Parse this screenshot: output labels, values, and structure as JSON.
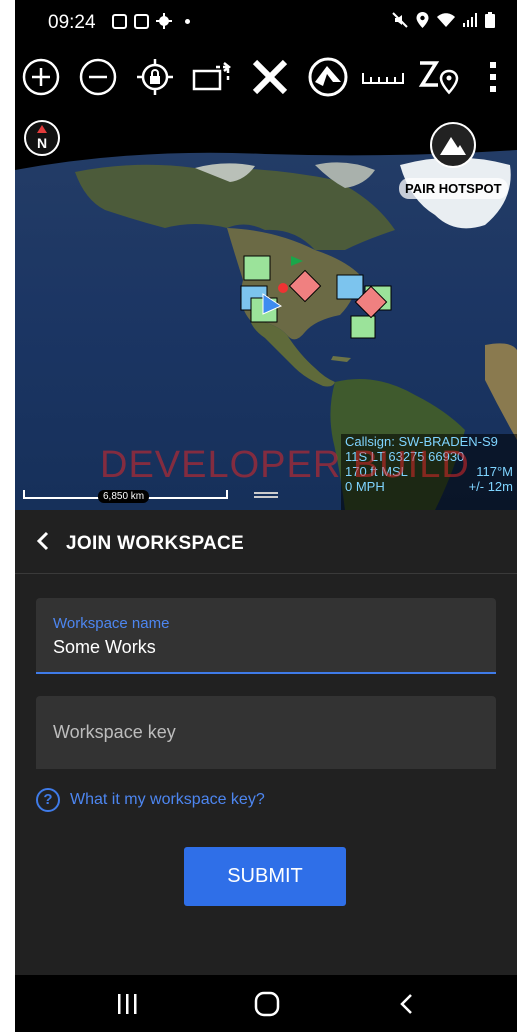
{
  "status_bar": {
    "time": "09:24",
    "left_icons": [
      "messenger-icon",
      "gallery-icon",
      "settings-icon",
      "dot-icon"
    ],
    "right_icons": [
      "mute-icon",
      "location-icon",
      "wifi-icon",
      "signal-icon",
      "battery-icon"
    ]
  },
  "toolbar": {
    "icons": [
      "zoom-in-icon",
      "zoom-out-icon",
      "lock-location-icon",
      "rotate-icon",
      "close-tool-icon",
      "atak-logo-icon",
      "ruler-icon",
      "zoom-location-icon",
      "overflow-menu-icon"
    ]
  },
  "map": {
    "compass_label": "N",
    "pair_hotspot_label": "PAIR HOTSPOT",
    "watermark": "DEVELOPER BUILD",
    "scale_label": "6,850 km",
    "info": {
      "callsign": "Callsign: SW-BRADEN-S9",
      "grid": "11S LT 63275 66930",
      "altitude": "170 ft MSL",
      "heading": "117°M",
      "speed": "0 MPH",
      "accuracy": "+/- 12m"
    }
  },
  "panel": {
    "title": "JOIN WORKSPACE",
    "name_field": {
      "label": "Workspace name",
      "value": "Some Works"
    },
    "key_field": {
      "placeholder": "Workspace key"
    },
    "help_text": "What it my workspace key?",
    "submit_label": "SUBMIT"
  },
  "nav_bar": {
    "icons": [
      "recents-icon",
      "home-icon",
      "back-icon"
    ]
  },
  "colors": {
    "accent": "#2f6fe8",
    "panel_bg": "#212121",
    "field_bg": "#333333",
    "info_text": "#7fd4ff",
    "watermark": "#dc2828"
  }
}
